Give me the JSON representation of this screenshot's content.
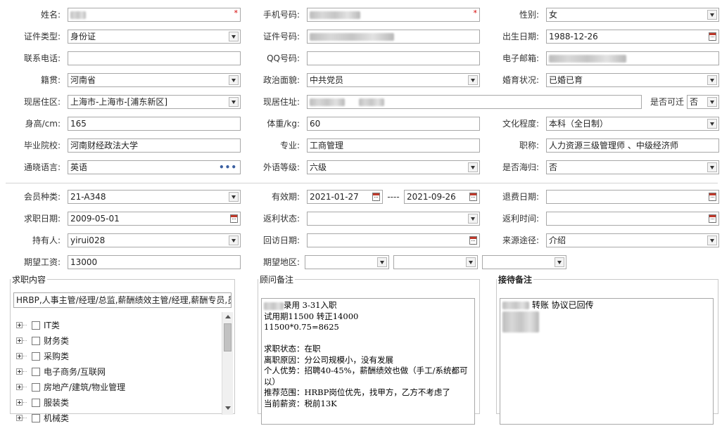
{
  "row1": {
    "name_label": "姓名:",
    "phone_label": "手机号码:",
    "gender_label": "性别:",
    "required_mark": "*",
    "gender_value": "女"
  },
  "row2": {
    "idtype_label": "证件类型:",
    "idtype_value": "身份证",
    "idno_label": "证件号码:",
    "birth_label": "出生日期:",
    "birth_value": "1988-12-26"
  },
  "row3": {
    "tel_label": "联系电话:",
    "qq_label": "QQ号码:",
    "email_label": "电子邮箱:"
  },
  "row4": {
    "native_label": "籍贯:",
    "native_value": "河南省",
    "political_label": "政治面貌:",
    "political_value": "中共党员",
    "marital_label": "婚育状况:",
    "marital_value": "已婚已育"
  },
  "row5": {
    "area_label": "现居住区:",
    "area_value": "上海市-上海市-[浦东新区]",
    "address_label": "现居住址:",
    "relocate_label": "是否可迁",
    "relocate_value": "否"
  },
  "row6": {
    "height_label": "身高/cm:",
    "height_value": "165",
    "weight_label": "体重/kg:",
    "weight_value": "60",
    "edu_label": "文化程度:",
    "edu_value": "本科（全日制）"
  },
  "row7": {
    "school_label": "毕业院校:",
    "school_value": "河南财经政法大学",
    "major_label": "专业:",
    "major_value": "工商管理",
    "title_label": "职称:",
    "title_value": "人力资源三级管理师 、中级经济师"
  },
  "row8": {
    "lang_label": "通晓语言:",
    "lang_value": "英语",
    "lang_more": "•••",
    "langlevel_label": "外语等级:",
    "langlevel_value": "六级",
    "overseas_label": "是否海归:",
    "overseas_value": "否"
  },
  "row9": {
    "member_label": "会员种类:",
    "member_value": "21-A348",
    "valid_label": "有效期:",
    "valid_from": "2021-01-27",
    "valid_sep": "----",
    "valid_to": "2021-09-26",
    "refund_label": "退费日期:"
  },
  "row10": {
    "jobdate_label": "求职日期:",
    "jobdate_value": "2009-05-01",
    "rebate_status_label": "返利状态:",
    "rebate_time_label": "返利时间:"
  },
  "row11": {
    "holder_label": "持有人:",
    "holder_value": "yirui028",
    "visit_label": "回访日期:",
    "source_label": "来源途径:",
    "source_value": "介绍"
  },
  "row12": {
    "salary_label": "期望工资:",
    "salary_value": "13000",
    "region_label": "期望地区:"
  },
  "job_content": {
    "legend": "求职内容",
    "summary": "HRBP,人事主管/经理/总监,薪酬绩效主管/经理,薪酬专员,员",
    "tree": [
      "IT类",
      "财务类",
      "采购类",
      "电子商务/互联网",
      "房地产/建筑/物业管理",
      "服装类",
      "机械类"
    ]
  },
  "advisor": {
    "legend": "顾问备注",
    "lines": [
      "录用 3-31入职",
      "试用期11500 转正14000",
      "11500*0.75=8625",
      "",
      "求职状态：在职",
      "离职原因：分公司规模小，没有发展",
      "个人优势：招聘40-45%，薪酬绩效也做（手工/系统都可",
      "以）",
      "推荐范围：HRBP岗位优先，找甲方，乙方不考虑了",
      "当前薪资：税前13K"
    ]
  },
  "reception": {
    "legend": "接待备注",
    "text": "转账 协议已回传"
  }
}
